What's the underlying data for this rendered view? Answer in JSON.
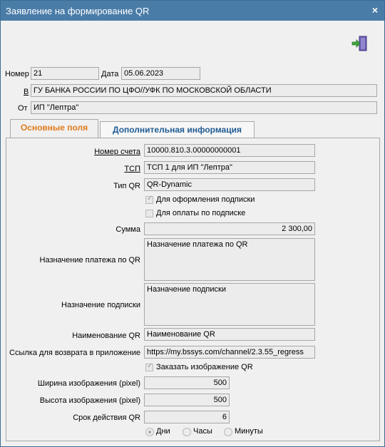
{
  "window": {
    "title": "Заявление на формирование QR",
    "close": "×"
  },
  "header": {
    "number_label": "Номер",
    "number_value": "21",
    "date_label": "Дата",
    "date_value": "05.06.2023",
    "to_label": "В",
    "to_value": "ГУ БАНКА РОССИИ ПО ЦФО//УФК ПО МОСКОВСКОЙ ОБЛАСТИ",
    "from_label": "От",
    "from_value": "ИП \"Лептра\""
  },
  "tabs": [
    {
      "label": "Основные поля",
      "active": true
    },
    {
      "label": "Дополнительная информация",
      "active": false
    }
  ],
  "form": {
    "account_label": "Номер счета",
    "account_value": "10000.810.3.00000000001",
    "tsp_label": "ТСП",
    "tsp_value": "ТСП 1 для ИП \"Лептра\"",
    "qr_type_label": "Тип QR",
    "qr_type_value": "QR-Dynamic",
    "subscription_setup_label": "Для оформления подписки",
    "subscription_setup_checked": true,
    "subscription_payment_label": "Для оплаты по подписке",
    "subscription_payment_checked": false,
    "sum_label": "Сумма",
    "sum_value": "2 300,00",
    "payment_purpose_label": "Назначение платежа по QR",
    "payment_purpose_value": "Назначение платежа по QR",
    "subscription_purpose_label": "Назначение подписки",
    "subscription_purpose_value": "Назначение подписки",
    "qr_name_label": "Наименование QR",
    "qr_name_value": "Наименование QR",
    "return_link_label": "Ссылка для возврата в приложение",
    "return_link_value": "https://my.bssys.com/channel/2.3.55_regress",
    "order_image_label": "Заказать изображение QR",
    "order_image_checked": true,
    "width_label": "Ширина изображения (pixel)",
    "width_value": "500",
    "height_label": "Высота изображения (pixel)",
    "height_value": "500",
    "validity_label": "Срок действия QR",
    "validity_value": "6",
    "validity_units": [
      {
        "label": "Дни",
        "selected": true
      },
      {
        "label": "Часы",
        "selected": false
      },
      {
        "label": "Минуты",
        "selected": false
      }
    ]
  },
  "colors": {
    "titlebar": "#4a7ca8",
    "active_tab": "#e07b1d",
    "inactive_tab": "#1f5a92"
  },
  "icons": {
    "exit": "exit-door-icon"
  }
}
